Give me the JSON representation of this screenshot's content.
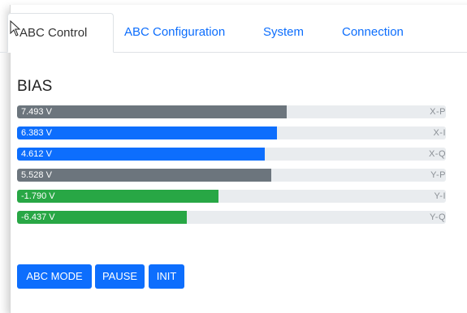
{
  "tabs": [
    {
      "label": "ABC Control",
      "active": true
    },
    {
      "label": "ABC Configuration",
      "active": false
    },
    {
      "label": "System",
      "active": false
    },
    {
      "label": "Connection",
      "active": false
    }
  ],
  "bias": {
    "title": "BIAS",
    "bars": [
      {
        "value": "7.493 V",
        "label": "X-P",
        "level": 0.629,
        "color": "#6c757d"
      },
      {
        "value": "6.383 V",
        "label": "X-I",
        "level": 0.607,
        "color": "#0d6efd"
      },
      {
        "value": "4.612 V",
        "label": "X-Q",
        "level": 0.578,
        "color": "#0d6efd"
      },
      {
        "value": "5.528 V",
        "label": "Y-P",
        "level": 0.593,
        "color": "#6c757d"
      },
      {
        "value": "-1.790 V",
        "label": "Y-I",
        "level": 0.47,
        "color": "#28a745"
      },
      {
        "value": "-6.437 V",
        "label": "Y-Q",
        "level": 0.395,
        "color": "#28a745"
      }
    ]
  },
  "buttons": [
    {
      "label": "ABC MODE"
    },
    {
      "label": "PAUSE"
    },
    {
      "label": "INIT"
    }
  ],
  "colors": {
    "primary": "#0d6efd",
    "secondary": "#6c757d",
    "success": "#28a745",
    "track": "#e9ecef"
  },
  "icons": {
    "cursor": "mouse-pointer-icon"
  }
}
